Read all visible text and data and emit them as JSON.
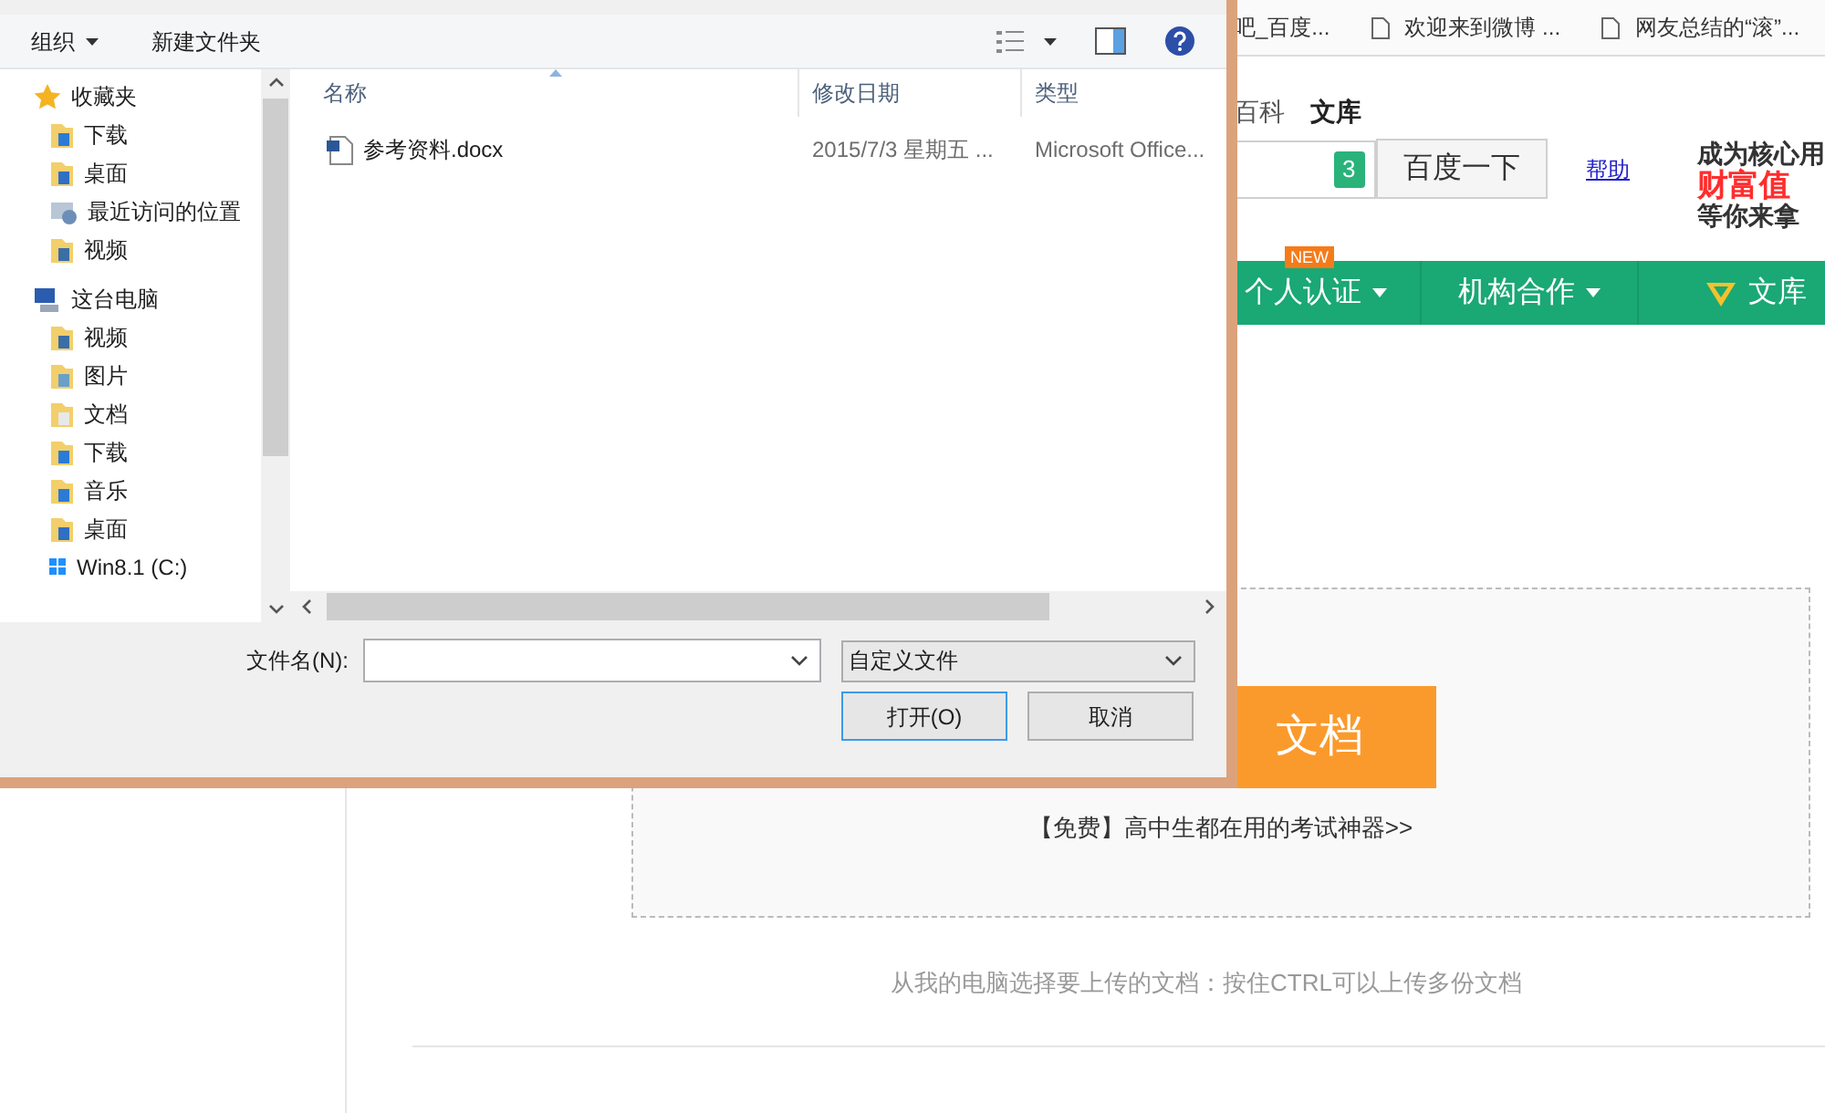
{
  "bookmarks": [
    "吧_百度...",
    "欢迎来到微博 ...",
    "网友总结的“滚”..."
  ],
  "site_nav": [
    {
      "label": "百科",
      "selected": false
    },
    {
      "label": "文库",
      "selected": true
    }
  ],
  "search": {
    "badge": "3",
    "button": "百度一下",
    "help": "帮助"
  },
  "promo": {
    "line1": "成为核心用",
    "line2": "财富值",
    "line3": "等你来拿"
  },
  "menu": [
    {
      "label": "个人认证",
      "badge": "NEW",
      "kind": "dropdown"
    },
    {
      "label": "机构合作",
      "kind": "dropdown"
    },
    {
      "label": "文库",
      "kind": "vip"
    }
  ],
  "upload": {
    "button": "文档",
    "promo_link": "【免费】高中生都在用的考试神器>>",
    "hint": "从我的电脑选择要上传的文档：按住CTRL可以上传多份文档"
  },
  "dialog": {
    "toolbar": {
      "organize": "组织",
      "new_folder": "新建文件夹"
    },
    "nav_tree": [
      {
        "label": "收藏夹",
        "kind": "favorites",
        "children": [
          {
            "label": "下载",
            "kind": "downloads"
          },
          {
            "label": "桌面",
            "kind": "desktop"
          },
          {
            "label": "最近访问的位置",
            "kind": "recent"
          },
          {
            "label": "视频",
            "kind": "videos"
          }
        ]
      },
      {
        "label": "这台电脑",
        "kind": "computer",
        "children": [
          {
            "label": "视频",
            "kind": "videos"
          },
          {
            "label": "图片",
            "kind": "pictures"
          },
          {
            "label": "文档",
            "kind": "documents"
          },
          {
            "label": "下载",
            "kind": "downloads"
          },
          {
            "label": "音乐",
            "kind": "music"
          },
          {
            "label": "桌面",
            "kind": "desktop"
          },
          {
            "label": "Win8.1 (C:)",
            "kind": "drive"
          }
        ]
      }
    ],
    "columns": [
      "名称",
      "修改日期",
      "类型"
    ],
    "files": [
      {
        "name": "参考资料.docx",
        "modified": "2015/7/3 星期五 ...",
        "type": "Microsoft Office...",
        "selected": false
      }
    ],
    "filename_label": "文件名(N):",
    "filter": "自定义文件",
    "buttons": [
      {
        "label": "打开(O)",
        "default": true
      },
      {
        "label": "取消",
        "default": false
      }
    ]
  }
}
